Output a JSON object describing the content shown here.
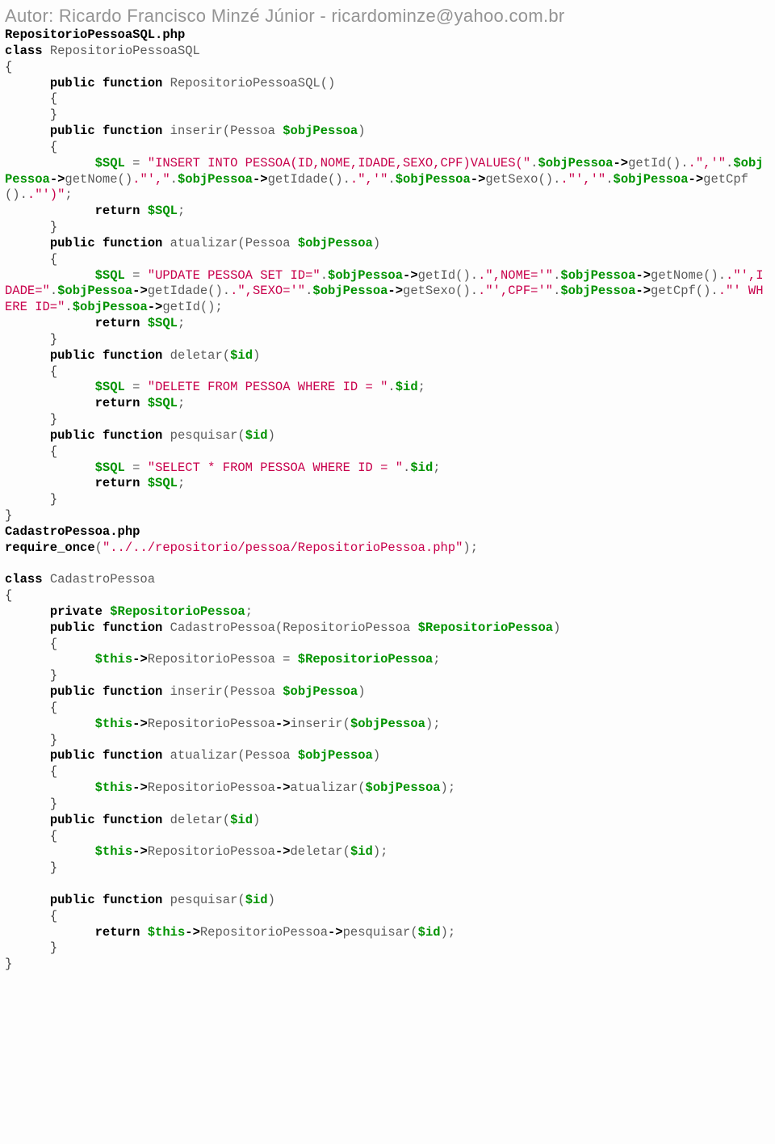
{
  "author_line": "Autor: Ricardo Francisco Minzé Júnior - ricardominze@yahoo.com.br",
  "file1": "RepositorioPessoa",
  "src1": "SQL.php",
  "class1": "RepositorioPessoaSQL",
  "ctor1": "RepositorioPessoaSQL()",
  "arg_pessoa": "(Pessoa ",
  "obj": "$objPessoa",
  "sqlv": "$SQL",
  "idv": "$id",
  "thisv": "$this",
  "repo": "$RepositorioPessoa",
  "ins_str": "\"INSERT INTO PESSOA(ID,NOME,IDADE,SEXO,CPF)VALUES(\"",
  "comma_q": ".\",'\"",
  "q_comma": ".\"',\"",
  "q_comma_q": ".\"','\"",
  "close_ins": ".\"')\"",
  "upd_str": "\"UPDATE PESSOA SET ID=\"",
  "nome_eq": ".\",NOME='\"",
  "idade_eq": ".\"',IDADE=\"",
  "sexo_eq": ".\",SEXO='\"",
  "cpf_eq": ".\"',CPF='\"",
  "where_id": ".\"' WHERE ID=\"",
  "del_str": "\"DELETE FROM PESSOA WHERE ID = \"",
  "sel_str": "\"SELECT * FROM PESSOA WHERE ID = \"",
  "file2": "CadastroPessoa.php",
  "require_path": "\"../../repositorio/pessoa/RepositorioPessoa.php\"",
  "class2": "CadastroPessoa",
  "ctor2_sig": "CadastroPessoa(RepositorioPessoa ",
  "kw": {
    "class": "class ",
    "public": "public",
    "function": "function",
    "private": "private",
    "return": "return",
    "require_once": "require_once"
  },
  "m": {
    "inserir": "inserir",
    "atualizar": "atualizar",
    "deletar": "deletar",
    "pesquisar": "pesquisar",
    "getId": "getId().",
    "getNome": "getNome().",
    "getIdade": "getIdade().",
    "getSexo": "getSexo().",
    "getCpf": "getCpf()."
  }
}
